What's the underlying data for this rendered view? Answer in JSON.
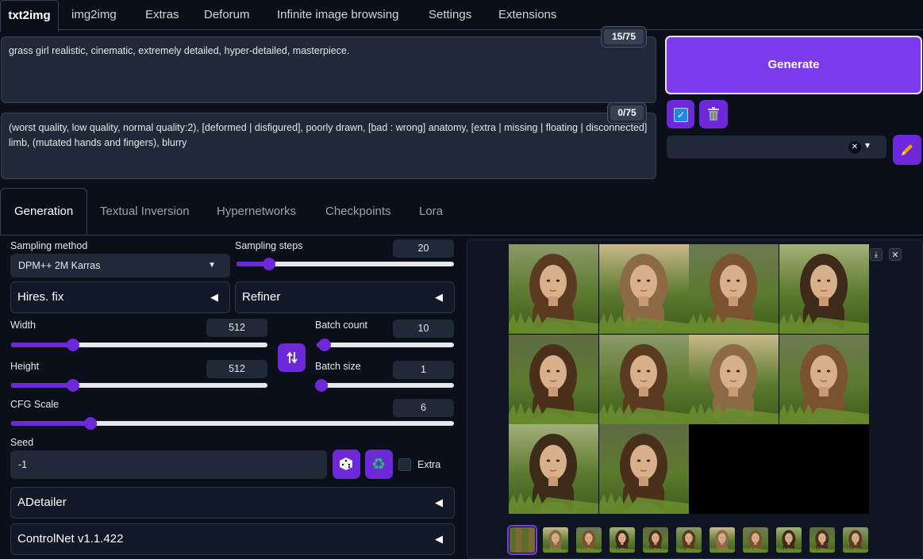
{
  "tabs": [
    "txt2img",
    "img2img",
    "Extras",
    "Deforum",
    "Infinite image browsing",
    "Settings",
    "Extensions"
  ],
  "prompt": {
    "positive": "grass girl realistic, cinematic, extremely detailed, hyper-detailed, masterpiece.",
    "positive_count": "15/75",
    "negative": "(worst quality, low quality, normal quality:2), [deformed | disfigured], poorly drawn, [bad : wrong] anatomy, [extra | missing | floating | disconnected] limb, (mutated hands and fingers), blurry",
    "negative_count": "0/75"
  },
  "actions": {
    "generate": "Generate",
    "style_clear": "✕",
    "style_arrow": "▾"
  },
  "subtabs": [
    "Generation",
    "Textual Inversion",
    "Hypernetworks",
    "Checkpoints",
    "Lora"
  ],
  "settings": {
    "sampling_method_label": "Sampling method",
    "sampling_method": "DPM++ 2M Karras",
    "sampling_steps_label": "Sampling steps",
    "sampling_steps": "20",
    "hires_fix": "Hires. fix",
    "refiner": "Refiner",
    "width_label": "Width",
    "width": "512",
    "height_label": "Height",
    "height": "512",
    "batch_count_label": "Batch count",
    "batch_count": "10",
    "batch_size_label": "Batch size",
    "batch_size": "1",
    "cfg_label": "CFG Scale",
    "cfg": "6",
    "seed_label": "Seed",
    "seed": "-1",
    "extra_label": "Extra",
    "adetailer": "ADetailer",
    "controlnet": "ControlNet v1.1.422"
  },
  "sliders": {
    "sampling_steps": 0.15,
    "width": 0.24,
    "height": 0.24,
    "batch_count": 0.06,
    "batch_size": 0.0,
    "cfg": 0.18
  },
  "gallery": {
    "image_count": 10,
    "thumbnail_count": 11
  },
  "colors": {
    "accent": "#7c3aed",
    "background": "#0b0f19"
  }
}
